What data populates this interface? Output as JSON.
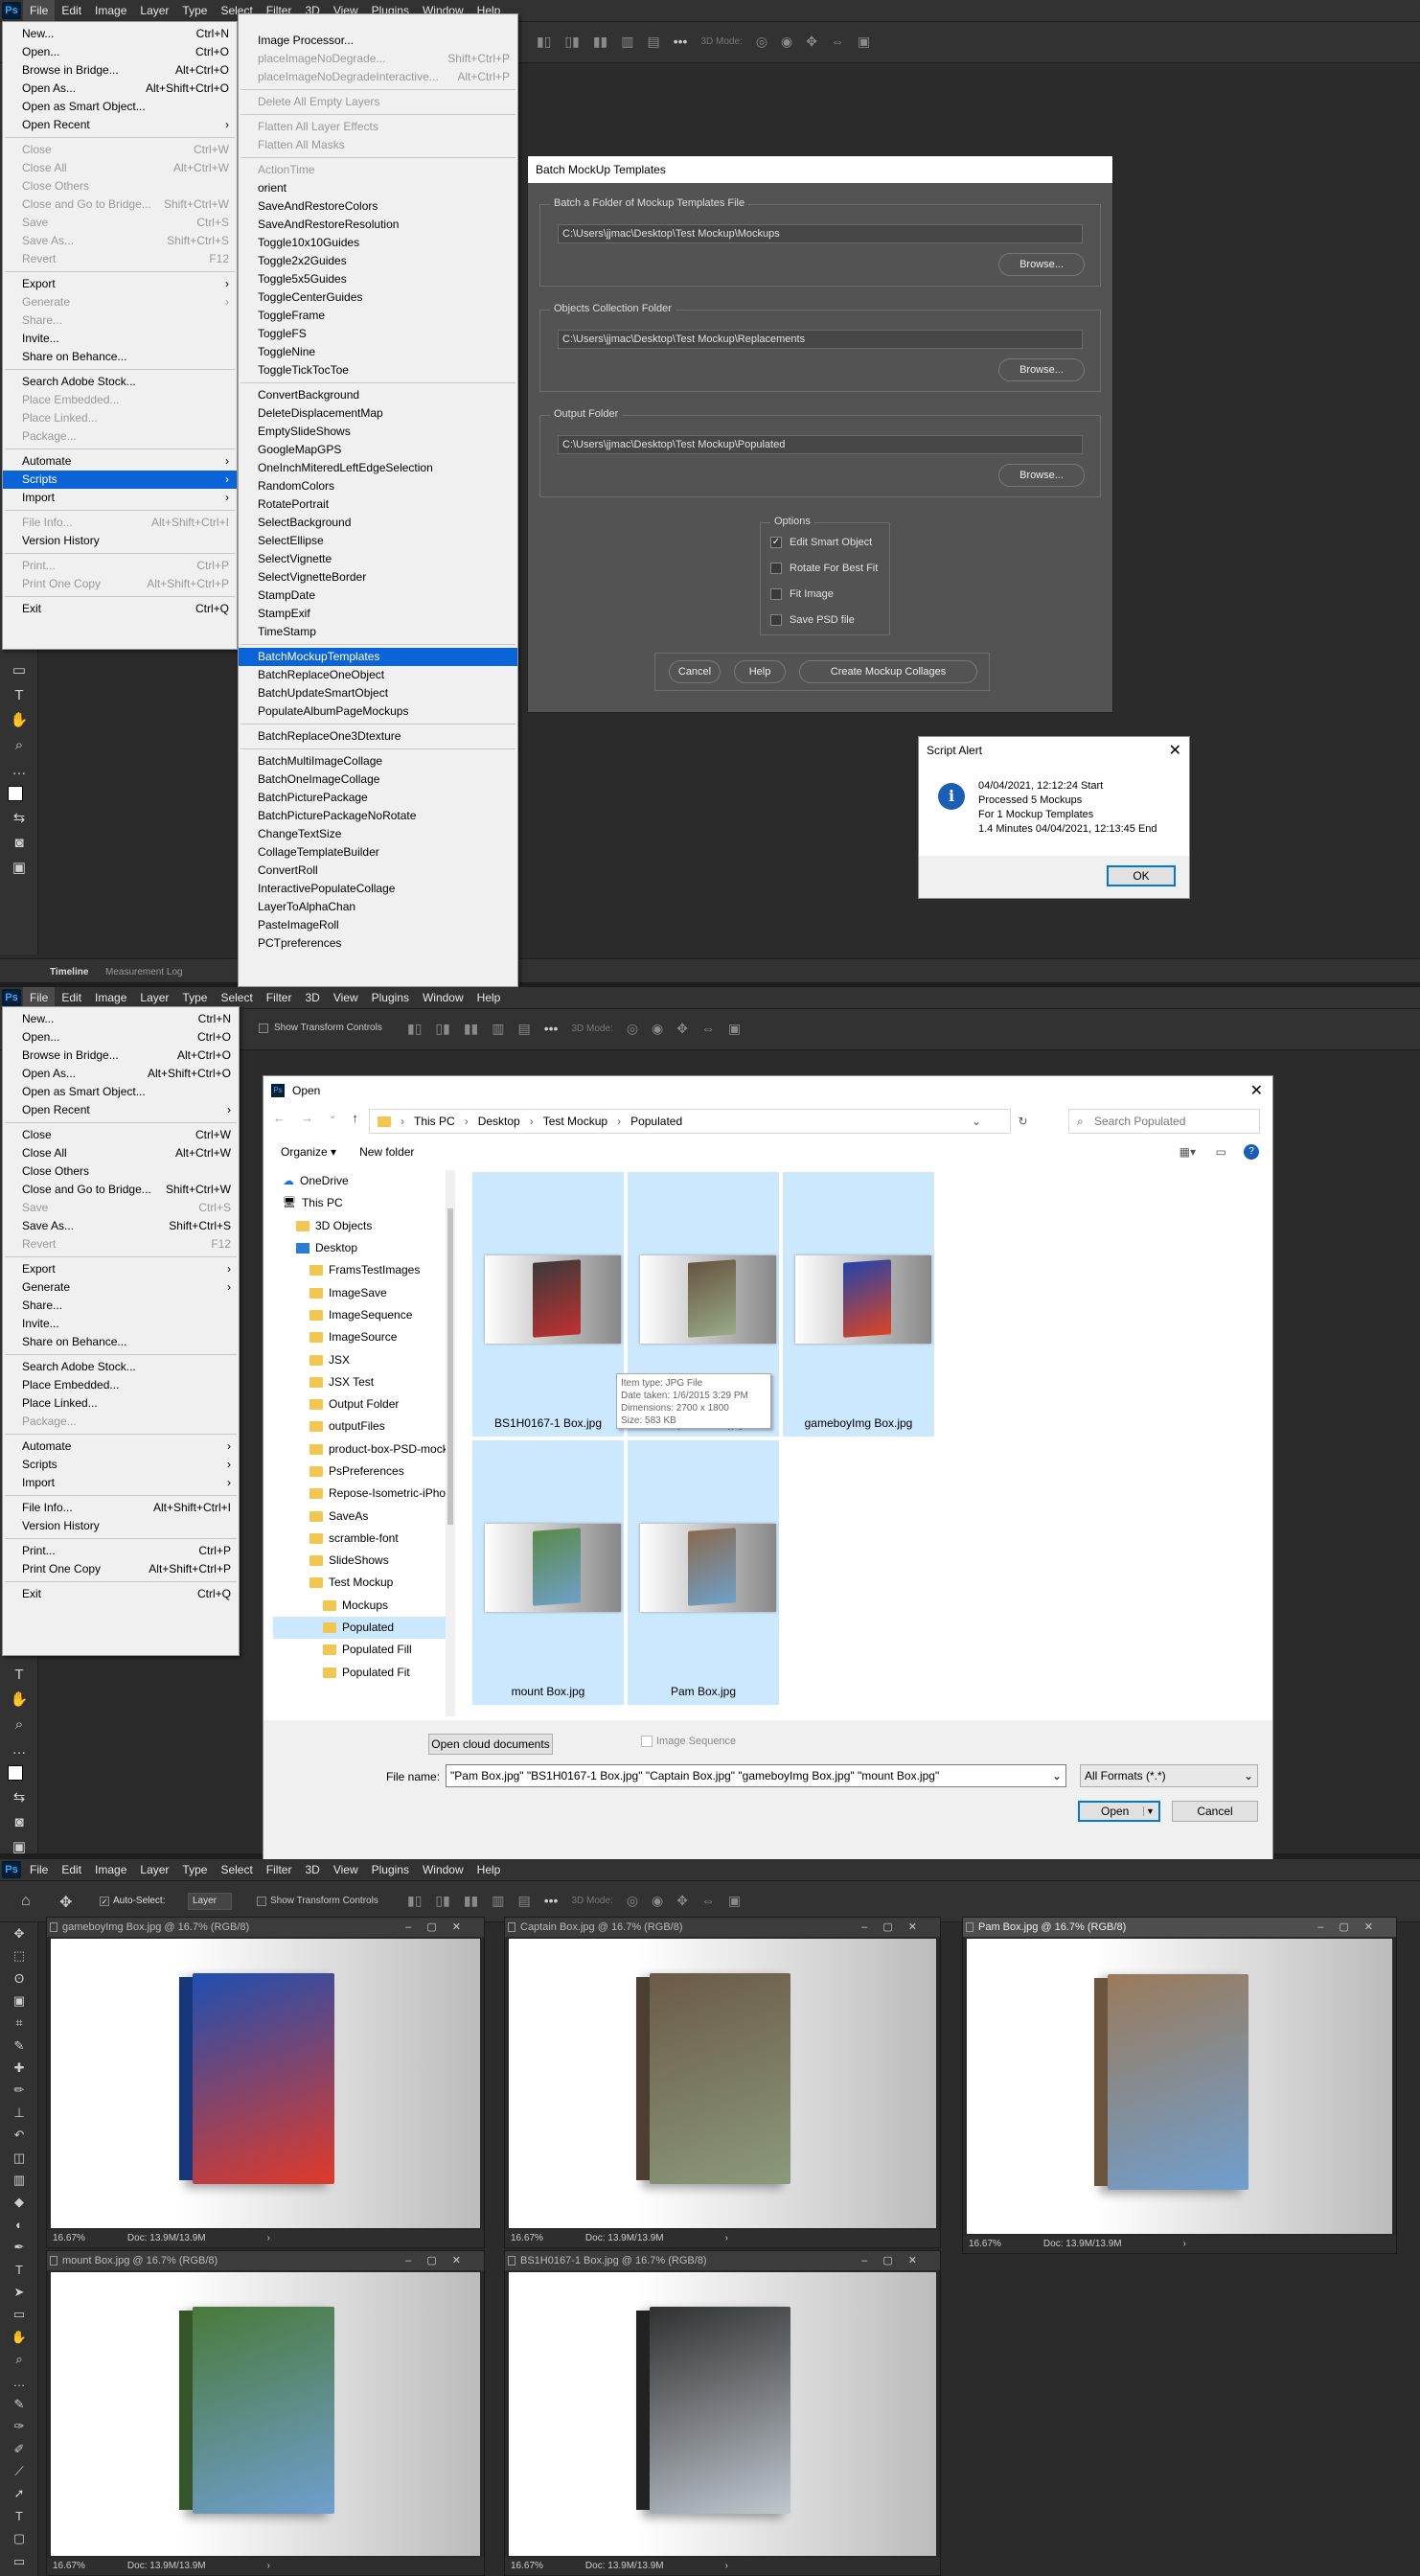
{
  "panel1": {
    "menubar": [
      "File",
      "Edit",
      "Image",
      "Layer",
      "Type",
      "Select",
      "Filter",
      "3D",
      "View",
      "Plugins",
      "Window",
      "Help"
    ],
    "file_menu": [
      {
        "label": "New...",
        "sc": "Ctrl+N"
      },
      {
        "label": "Open...",
        "sc": "Ctrl+O"
      },
      {
        "label": "Browse in Bridge...",
        "sc": "Alt+Ctrl+O"
      },
      {
        "label": "Open As...",
        "sc": "Alt+Shift+Ctrl+O"
      },
      {
        "label": "Open as Smart Object...",
        "sc": ""
      },
      {
        "label": "Open Recent",
        "sc": "›"
      },
      {
        "sep": true
      },
      {
        "label": "Close",
        "sc": "Ctrl+W",
        "dis": true
      },
      {
        "label": "Close All",
        "sc": "Alt+Ctrl+W",
        "dis": true
      },
      {
        "label": "Close Others",
        "sc": "",
        "dis": true
      },
      {
        "label": "Close and Go to Bridge...",
        "sc": "Shift+Ctrl+W",
        "dis": true
      },
      {
        "label": "Save",
        "sc": "Ctrl+S",
        "dis": true
      },
      {
        "label": "Save As...",
        "sc": "Shift+Ctrl+S",
        "dis": true
      },
      {
        "label": "Revert",
        "sc": "F12",
        "dis": true
      },
      {
        "sep": true
      },
      {
        "label": "Export",
        "sc": "›"
      },
      {
        "label": "Generate",
        "sc": "›",
        "dis": true
      },
      {
        "label": "Share...",
        "sc": "",
        "dis": true
      },
      {
        "label": "Invite...",
        "sc": ""
      },
      {
        "label": "Share on Behance...",
        "sc": ""
      },
      {
        "sep": true
      },
      {
        "label": "Search Adobe Stock...",
        "sc": ""
      },
      {
        "label": "Place Embedded...",
        "sc": "",
        "dis": true
      },
      {
        "label": "Place Linked...",
        "sc": "",
        "dis": true
      },
      {
        "label": "Package...",
        "sc": "",
        "dis": true
      },
      {
        "sep": true
      },
      {
        "label": "Automate",
        "sc": "›"
      },
      {
        "label": "Scripts",
        "sc": "›",
        "sel": true
      },
      {
        "label": "Import",
        "sc": "›"
      },
      {
        "sep": true
      },
      {
        "label": "File Info...",
        "sc": "Alt+Shift+Ctrl+I",
        "dis": true
      },
      {
        "label": "Version History",
        "sc": ""
      },
      {
        "sep": true
      },
      {
        "label": "Print...",
        "sc": "Ctrl+P",
        "dis": true
      },
      {
        "label": "Print One Copy",
        "sc": "Alt+Shift+Ctrl+P",
        "dis": true
      },
      {
        "sep": true
      },
      {
        "label": "Exit",
        "sc": "Ctrl+Q"
      }
    ],
    "scripts_menu": [
      {
        "label": "Image Processor...",
        "sc": ""
      },
      {
        "label": "placeImageNoDegrade...",
        "sc": "Shift+Ctrl+P",
        "dis": true
      },
      {
        "label": "placeImageNoDegradeInteractive...",
        "sc": "Alt+Ctrl+P",
        "dis": true
      },
      {
        "sep": true
      },
      {
        "label": "Delete All Empty Layers",
        "sc": "",
        "dis": true
      },
      {
        "sep": true
      },
      {
        "label": "Flatten All Layer Effects",
        "sc": "",
        "dis": true
      },
      {
        "label": "Flatten All Masks",
        "sc": "",
        "dis": true
      },
      {
        "sep": true
      },
      {
        "label": "ActionTime",
        "sc": "",
        "dis": true
      },
      {
        "label": "orient",
        "sc": ""
      },
      {
        "label": "SaveAndRestoreColors",
        "sc": ""
      },
      {
        "label": "SaveAndRestoreResolution",
        "sc": ""
      },
      {
        "label": "Toggle10x10Guides",
        "sc": ""
      },
      {
        "label": "Toggle2x2Guides",
        "sc": ""
      },
      {
        "label": "Toggle5x5Guides",
        "sc": ""
      },
      {
        "label": "ToggleCenterGuides",
        "sc": ""
      },
      {
        "label": "ToggleFrame",
        "sc": ""
      },
      {
        "label": "ToggleFS",
        "sc": ""
      },
      {
        "label": "ToggleNine",
        "sc": ""
      },
      {
        "label": "ToggleTickTocToe",
        "sc": ""
      },
      {
        "sep": true
      },
      {
        "label": "ConvertBackground",
        "sc": ""
      },
      {
        "label": "DeleteDisplacementMap",
        "sc": ""
      },
      {
        "label": "EmptySlideShows",
        "sc": ""
      },
      {
        "label": "GoogleMapGPS",
        "sc": ""
      },
      {
        "label": "OneInchMiteredLeftEdgeSelection",
        "sc": ""
      },
      {
        "label": "RandomColors",
        "sc": ""
      },
      {
        "label": "RotatePortrait",
        "sc": ""
      },
      {
        "label": "SelectBackground",
        "sc": ""
      },
      {
        "label": "SelectEllipse",
        "sc": ""
      },
      {
        "label": "SelectVignette",
        "sc": ""
      },
      {
        "label": "SelectVignetteBorder",
        "sc": ""
      },
      {
        "label": "StampDate",
        "sc": ""
      },
      {
        "label": "StampExif",
        "sc": ""
      },
      {
        "label": "TimeStamp",
        "sc": ""
      },
      {
        "sep": true
      },
      {
        "label": "BatchMockupTemplates",
        "sc": "",
        "sel": true
      },
      {
        "label": "BatchReplaceOneObject",
        "sc": ""
      },
      {
        "label": "BatchUpdateSmartObject",
        "sc": ""
      },
      {
        "label": "PopulateAlbumPageMockups",
        "sc": ""
      },
      {
        "sep": true
      },
      {
        "label": "BatchReplaceOne3Dtexture",
        "sc": ""
      },
      {
        "sep": true
      },
      {
        "label": "BatchMultiImageCollage",
        "sc": ""
      },
      {
        "label": "BatchOneImageCollage",
        "sc": ""
      },
      {
        "label": "BatchPicturePackage",
        "sc": ""
      },
      {
        "label": "BatchPicturePackageNoRotate",
        "sc": ""
      },
      {
        "label": "ChangeTextSize",
        "sc": ""
      },
      {
        "label": "CollageTemplateBuilder",
        "sc": ""
      },
      {
        "label": "ConvertRoll",
        "sc": ""
      },
      {
        "label": "InteractivePopulateCollage",
        "sc": ""
      },
      {
        "label": "LayerToAlphaChan",
        "sc": ""
      },
      {
        "label": "PasteImageRoll",
        "sc": ""
      },
      {
        "label": "PCTpreferences",
        "sc": ""
      }
    ],
    "optbar_3d": "3D Mode:",
    "batch": {
      "title": "Batch MockUp Templates",
      "g1_label": "Batch a Folder of Mockup Templates File",
      "g1_path": "C:\\Users\\jjmac\\Desktop\\Test Mockup\\Mockups",
      "g2_label": "Objects Collection Folder",
      "g2_path": "C:\\Users\\jjmac\\Desktop\\Test Mockup\\Replacements",
      "g3_label": "Output Folder",
      "g3_path": "C:\\Users\\jjmac\\Desktop\\Test Mockup\\Populated",
      "browse": "Browse...",
      "options_label": "Options",
      "opt1": "Edit Smart Object",
      "opt2": "Rotate For Best Fit",
      "opt3": "Fit Image",
      "opt4": "Save PSD file",
      "cancel": "Cancel",
      "help": "Help",
      "create": "Create Mockup Collages"
    },
    "alert": {
      "title": "Script Alert",
      "l1": "04/04/2021, 12:12:24 Start",
      "l2": "Processed 5 Mockups",
      "l3": "For 1 Mockup Templates",
      "l4": "1.4 Minutes 04/04/2021, 12:13:45  End",
      "ok": "OK"
    },
    "tabs": [
      "Timeline",
      "Measurement Log"
    ]
  },
  "panel2": {
    "transform": "Show Transform Controls",
    "file_menu": [
      {
        "label": "New...",
        "sc": "Ctrl+N"
      },
      {
        "label": "Open...",
        "sc": "Ctrl+O"
      },
      {
        "label": "Browse in Bridge...",
        "sc": "Alt+Ctrl+O"
      },
      {
        "label": "Open As...",
        "sc": "Alt+Shift+Ctrl+O"
      },
      {
        "label": "Open as Smart Object...",
        "sc": ""
      },
      {
        "label": "Open Recent",
        "sc": "›"
      },
      {
        "sep": true
      },
      {
        "label": "Close",
        "sc": "Ctrl+W"
      },
      {
        "label": "Close All",
        "sc": "Alt+Ctrl+W"
      },
      {
        "label": "Close Others",
        "sc": ""
      },
      {
        "label": "Close and Go to Bridge...",
        "sc": "Shift+Ctrl+W"
      },
      {
        "label": "Save",
        "sc": "Ctrl+S",
        "dis": true
      },
      {
        "label": "Save As...",
        "sc": "Shift+Ctrl+S"
      },
      {
        "label": "Revert",
        "sc": "F12",
        "dis": true
      },
      {
        "sep": true
      },
      {
        "label": "Export",
        "sc": "›"
      },
      {
        "label": "Generate",
        "sc": "›"
      },
      {
        "label": "Share...",
        "sc": ""
      },
      {
        "label": "Invite...",
        "sc": ""
      },
      {
        "label": "Share on Behance...",
        "sc": ""
      },
      {
        "sep": true
      },
      {
        "label": "Search Adobe Stock...",
        "sc": ""
      },
      {
        "label": "Place Embedded...",
        "sc": ""
      },
      {
        "label": "Place Linked...",
        "sc": ""
      },
      {
        "label": "Package...",
        "sc": "",
        "dis": true
      },
      {
        "sep": true
      },
      {
        "label": "Automate",
        "sc": "›"
      },
      {
        "label": "Scripts",
        "sc": "›"
      },
      {
        "label": "Import",
        "sc": "›"
      },
      {
        "sep": true
      },
      {
        "label": "File Info...",
        "sc": "Alt+Shift+Ctrl+I"
      },
      {
        "label": "Version History",
        "sc": ""
      },
      {
        "sep": true
      },
      {
        "label": "Print...",
        "sc": "Ctrl+P"
      },
      {
        "label": "Print One Copy",
        "sc": "Alt+Shift+Ctrl+P"
      },
      {
        "sep": true
      },
      {
        "label": "Exit",
        "sc": "Ctrl+Q"
      }
    ],
    "open": {
      "title": "Open",
      "crumbs": [
        "This PC",
        "Desktop",
        "Test Mockup",
        "Populated"
      ],
      "search": "Search Populated",
      "organize": "Organize ▾",
      "newfolder": "New folder",
      "tree": [
        {
          "label": "OneDrive",
          "kind": "cloud",
          "ind": 0
        },
        {
          "label": "This PC",
          "kind": "pc",
          "ind": 0
        },
        {
          "label": "3D Objects",
          "kind": "f",
          "ind": 1
        },
        {
          "label": "Desktop",
          "kind": "d",
          "ind": 1
        },
        {
          "label": "FramsTestImages",
          "kind": "f",
          "ind": 2
        },
        {
          "label": "ImageSave",
          "kind": "f",
          "ind": 2
        },
        {
          "label": "ImageSequence",
          "kind": "f",
          "ind": 2
        },
        {
          "label": "ImageSource",
          "kind": "f",
          "ind": 2
        },
        {
          "label": "JSX",
          "kind": "f",
          "ind": 2
        },
        {
          "label": "JSX Test",
          "kind": "f",
          "ind": 2
        },
        {
          "label": "Output Folder",
          "kind": "f",
          "ind": 2
        },
        {
          "label": "outputFiles",
          "kind": "f",
          "ind": 2
        },
        {
          "label": "product-box-PSD-mockup",
          "kind": "f",
          "ind": 2
        },
        {
          "label": "PsPreferences",
          "kind": "f",
          "ind": 2
        },
        {
          "label": "Repose-Isometric-iPhone",
          "kind": "f",
          "ind": 2
        },
        {
          "label": "SaveAs",
          "kind": "f",
          "ind": 2
        },
        {
          "label": "scramble-font",
          "kind": "f",
          "ind": 2
        },
        {
          "label": "SlideShows",
          "kind": "f",
          "ind": 2
        },
        {
          "label": "Test Mockup",
          "kind": "f",
          "ind": 2
        },
        {
          "label": "Mockups",
          "kind": "f",
          "ind": 3
        },
        {
          "label": "Populated",
          "kind": "f",
          "ind": 3,
          "sel": true
        },
        {
          "label": "Populated Fill",
          "kind": "f",
          "ind": 3
        },
        {
          "label": "Populated Fit",
          "kind": "f",
          "ind": 3
        }
      ],
      "files": [
        {
          "name": "BS1H0167-1 Box.jpg",
          "c1": "#3a3a3a",
          "c2": "#c03030"
        },
        {
          "name": "Captain Box.jpg",
          "c1": "#665540",
          "c2": "#99aa88"
        },
        {
          "name": "gameboyImg Box.jpg",
          "c1": "#2244aa",
          "c2": "#dd4422"
        },
        {
          "name": "mount Box.jpg",
          "c1": "#5a8a4a",
          "c2": "#6fa0c8"
        },
        {
          "name": "Pam Box.jpg",
          "c1": "#8a6a50",
          "c2": "#6fa0c8"
        }
      ],
      "tooltip": [
        "Item type: JPG File",
        "Date taken: 1/6/2015 3:29 PM",
        "Dimensions: 2700 x 1800",
        "Size: 583 KB"
      ],
      "cloud": "Open cloud documents",
      "imgseq": "Image Sequence",
      "fname_label": "File name:",
      "fname": "\"Pam Box.jpg\" \"BS1H0167-1 Box.jpg\" \"Captain Box.jpg\" \"gameboyImg Box.jpg\" \"mount Box.jpg\"",
      "format": "All Formats (*.*)",
      "open_btn": "Open",
      "cancel": "Cancel"
    }
  },
  "panel3": {
    "autoselect": "Auto-Select:",
    "layer": "Layer",
    "transform": "Show Transform Controls",
    "docs": [
      {
        "title": "gameboyImg Box.jpg @ 16.7% (RGB/8)",
        "zoom": "16.67%",
        "doc": "Doc: 13.9M/13.9M",
        "c1": "#1f4fb0",
        "c2": "#e03a2a"
      },
      {
        "title": "Captain Box.jpg @ 16.7% (RGB/8)",
        "zoom": "16.67%",
        "doc": "Doc: 13.9M/13.9M",
        "c1": "#6b5a48",
        "c2": "#8b9a7a"
      },
      {
        "title": "Pam Box.jpg @ 16.7% (RGB/8)",
        "zoom": "16.67%",
        "doc": "Doc: 13.9M/13.9M",
        "c1": "#9a7a5a",
        "c2": "#6f9fcf"
      },
      {
        "title": "mount Box.jpg @ 16.7% (RGB/8)",
        "zoom": "16.67%",
        "doc": "Doc: 13.9M/13.9M",
        "c1": "#4a7a3a",
        "c2": "#6f9fcf"
      },
      {
        "title": "BS1H0167-1 Box.jpg @ 16.7% (RGB/8)",
        "zoom": "16.67%",
        "doc": "Doc: 13.9M/13.9M",
        "c1": "#303030",
        "c2": "#c0c8d0"
      }
    ]
  }
}
